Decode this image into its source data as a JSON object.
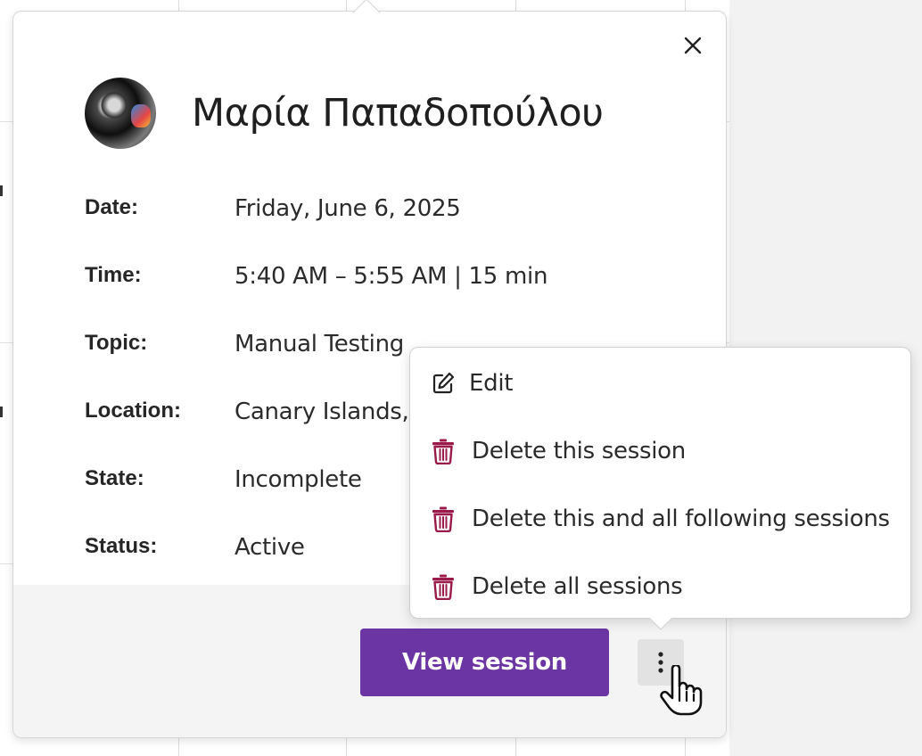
{
  "session_popover": {
    "close_label": "×",
    "attendee_name": "Μαρία Παπαδοπούλου",
    "details": [
      {
        "label": "Date:",
        "value": "Friday, June 6, 2025"
      },
      {
        "label": "Time:",
        "value": "5:40 AM – 5:55 AM | 15 min"
      },
      {
        "label": "Topic:",
        "value": "Manual Testing"
      },
      {
        "label": "Location:",
        "value": "Canary Islands,"
      },
      {
        "label": "State:",
        "value": "Incomplete"
      },
      {
        "label": "Status:",
        "value": "Active"
      }
    ],
    "view_button_label": "View session",
    "more_button_icon": "vertical-ellipsis-icon"
  },
  "actions_menu": {
    "items": [
      {
        "label": "Edit",
        "icon": "edit-icon"
      },
      {
        "label": "Delete this session",
        "icon": "trash-icon"
      },
      {
        "label": "Delete this and all following sessions",
        "icon": "trash-icon"
      },
      {
        "label": "Delete all sessions",
        "icon": "trash-icon"
      }
    ]
  },
  "colors": {
    "primary": "#6b36a3",
    "danger_icon": "#9a1b4b",
    "footer_bg": "#f4f4f4"
  }
}
